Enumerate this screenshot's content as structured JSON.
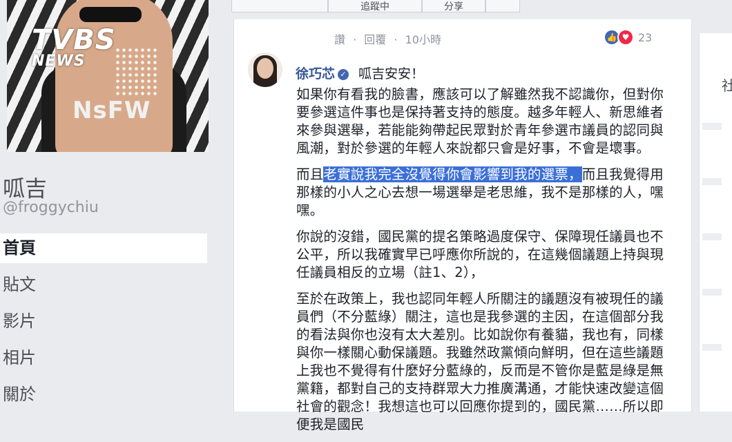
{
  "watermark": {
    "brand": "TVBS",
    "sub": "NEWS"
  },
  "cover": {
    "shirt_text": "NsFW"
  },
  "page": {
    "name": "呱吉",
    "handle": "@froggychiu",
    "nav": [
      "首頁",
      "貼文",
      "影片",
      "相片",
      "關於"
    ]
  },
  "top_buttons": [
    "追蹤中",
    "分享"
  ],
  "post": {
    "actions": [
      "讚",
      "·",
      "回覆",
      "·",
      "10小時"
    ],
    "reaction_count": "23",
    "author": "徐巧芯",
    "greeting": "呱吉安安！",
    "paragraphs": [
      "如果你有看我的臉書，應該可以了解雖然我不認識你，但對你要參選這件事也是保持著支持的態度。越多年輕人、新思維者來參與選舉，若能能夠帶起民眾對於青年參選市議員的認同與風潮，對於參選的年輕人來說都只會是好事，不會是壞事。",
      "你說的沒錯，國民黨的提名策略過度保守、保障現任議員也不公平，所以我確實早已呼應你所說的，在這幾個議題上持與現任議員相反的立場（註1、2），",
      "至於在政策上，我也認同年輕人所關注的議題沒有被現任的議員們（不分藍綠）關注，這也是我參選的主因，在這個部分我的看法與你也沒有太大差別。比如說你有養貓，我也有，同樣與你一樣關心動保議題。我雖然政黨傾向鮮明，但在這些議題上我也不覺得有什麼好分藍綠的，反而是不管你是藍是綠是無黨籍，都對自己的支持群眾大力推廣溝通，才能快速改變這個社會的觀念！我想這也可以回應你提到的，國民黨……所以即便我是國民"
    ],
    "p2_before": "而且",
    "p2_highlight": "老實說我完全沒覺得你會影響到我的選票，",
    "p2_after": "而且我覺得用那樣的小人之心去想一場選舉是老思維，我不是那樣的人，嘿嘿。"
  },
  "right_col": {
    "char": "社"
  }
}
